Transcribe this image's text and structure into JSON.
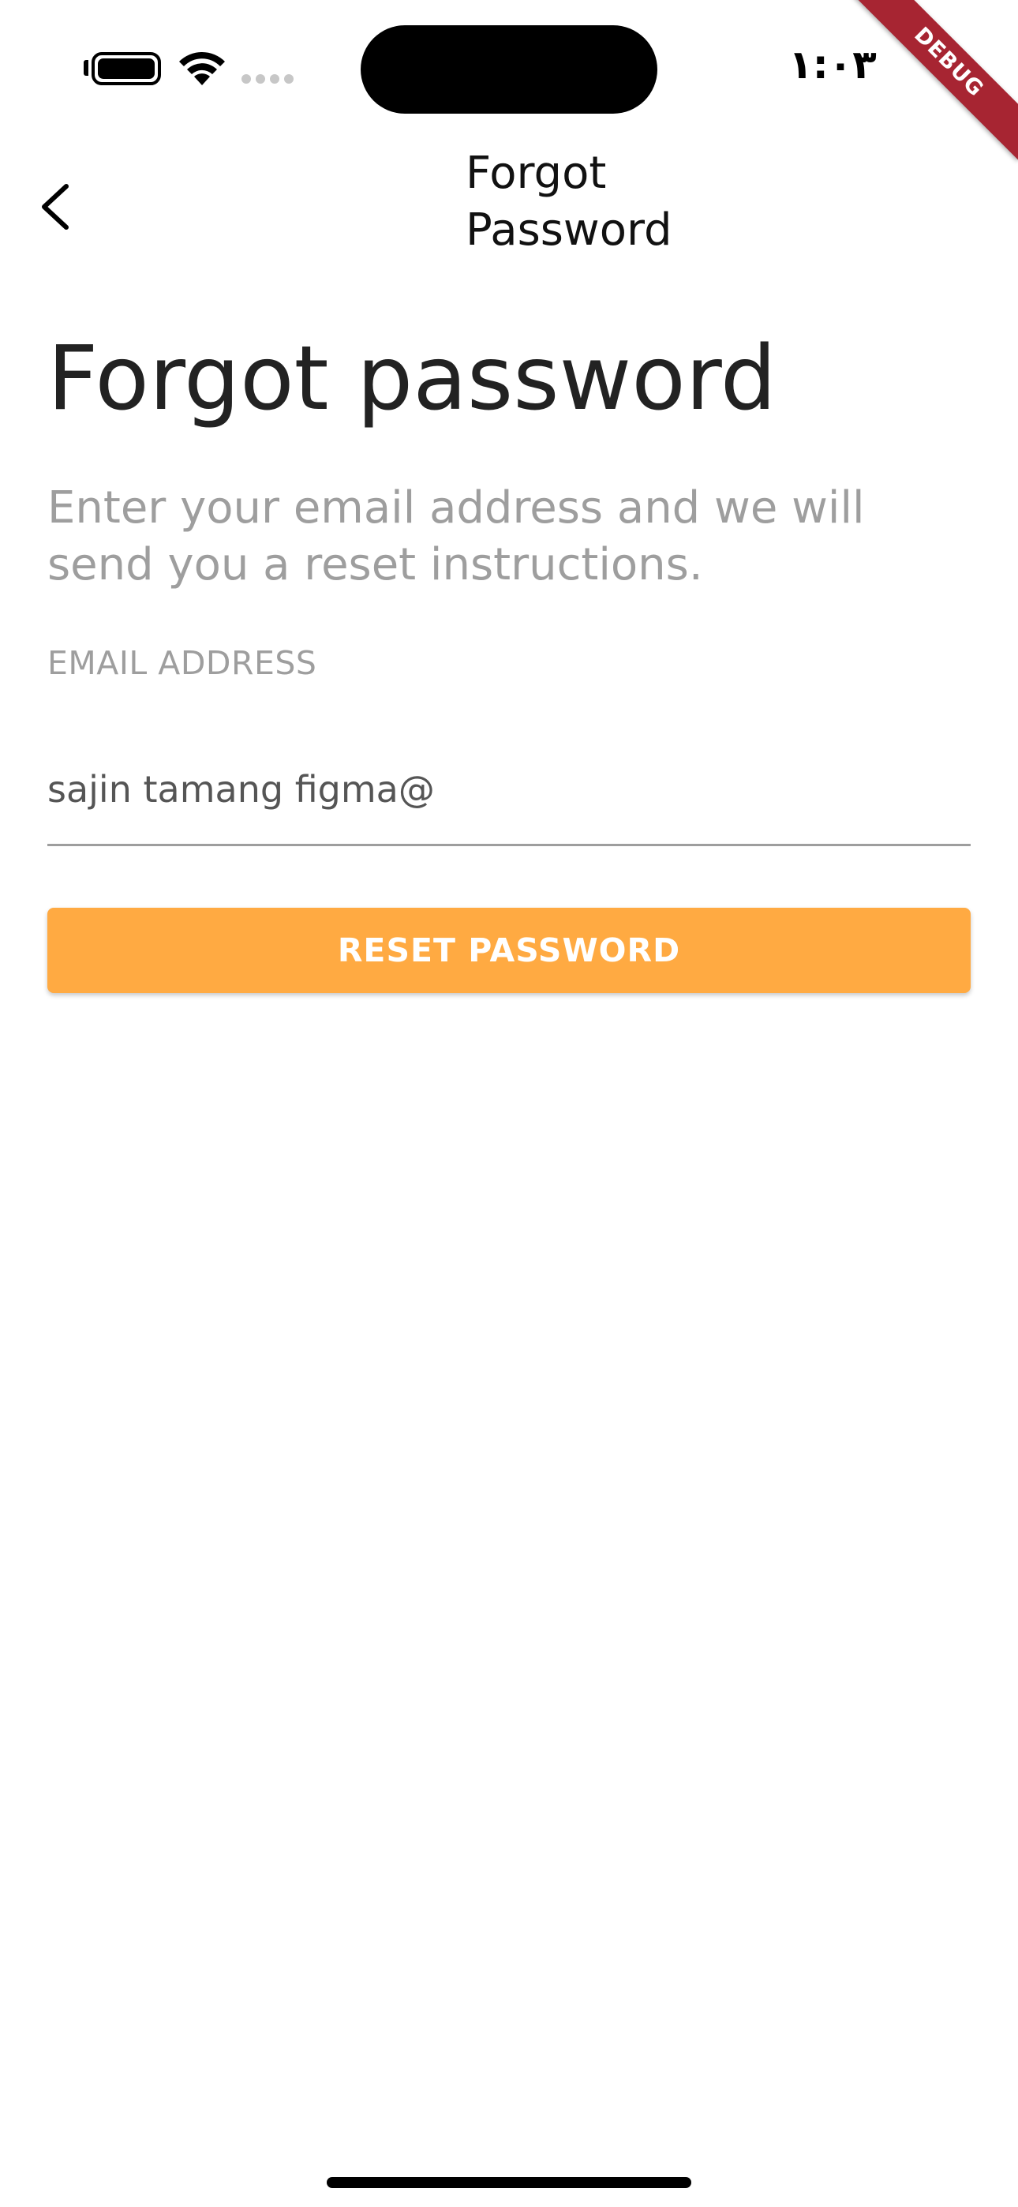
{
  "status_bar": {
    "time": "١:٠٣",
    "debug_banner": "DEBUG",
    "icons": [
      "battery-icon",
      "wifi-icon",
      "cellular-signal-icon"
    ]
  },
  "app_bar": {
    "title": "Forgot Password",
    "back_icon": "chevron-left-icon"
  },
  "main": {
    "heading": "Forgot password",
    "description": "Enter your email address and we will send you a reset instructions.",
    "email_label": "EMAIL ADDRESS",
    "email_value": "sajin tamang figma@",
    "reset_button_label": "RESET PASSWORD"
  },
  "colors": {
    "accent": "#ffaa42",
    "debug_banner": "#a72532",
    "secondary_text": "#9e9e9e",
    "primary_text": "#222222"
  }
}
